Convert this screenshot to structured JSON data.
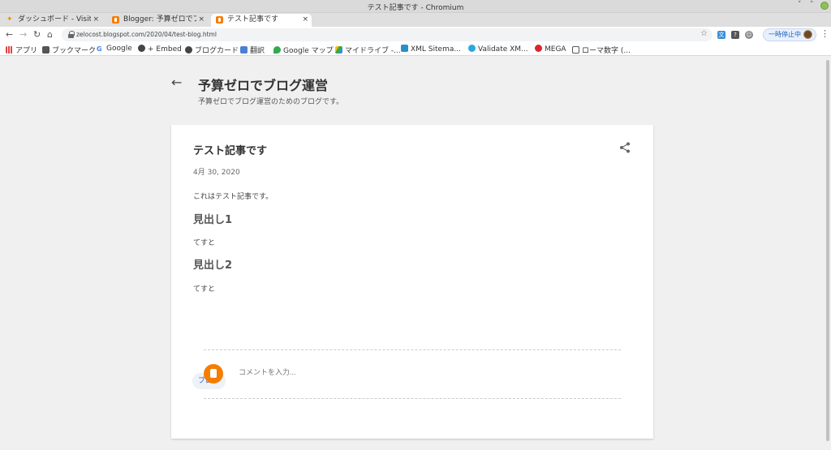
{
  "window": {
    "title": "テスト記事です - Chromium"
  },
  "tabs": [
    {
      "label": "ダッシュボード - Visitors",
      "close": "×"
    },
    {
      "label": "Blogger: 予算ゼロでブログ",
      "close": "×"
    },
    {
      "label": "テスト記事です",
      "close": "×"
    }
  ],
  "toolbar": {
    "url": "zelocost.blogspot.com/2020/04/test-blog.html",
    "pause_label": "一時停止中"
  },
  "bookmarks": [
    {
      "label": "アプリ",
      "icon": "apps-grid-icon"
    },
    {
      "label": "ブックマーク",
      "icon": "folder-icon"
    },
    {
      "label": "Google",
      "icon": "google-icon"
    },
    {
      "label": "+ Embed",
      "icon": "globe-icon"
    },
    {
      "label": "ブログカード",
      "icon": "globe-icon"
    },
    {
      "label": "翻訳",
      "icon": "translate-icon"
    },
    {
      "label": "Google マップ",
      "icon": "maps-pin-icon"
    },
    {
      "label": "マイドライブ -...",
      "icon": "drive-icon"
    },
    {
      "label": "XML Sitema...",
      "icon": "chart-icon"
    },
    {
      "label": "Validate XM...",
      "icon": "globe-icon"
    },
    {
      "label": "MEGA",
      "icon": "mega-icon"
    },
    {
      "label": "ローマ数字 (...",
      "icon": "doc-icon"
    }
  ],
  "blog": {
    "title": "予算ゼロでブログ運営",
    "description": "予算ゼロでブログ運営のためのブログです。"
  },
  "post": {
    "title": "テスト記事です",
    "date": "4月 30, 2020",
    "intro": "これはテスト記事です。",
    "heading1": "見出し1",
    "text1": "てすと",
    "heading2": "見出し2",
    "text2": "てすと",
    "label": "ブログ"
  },
  "comments": {
    "placeholder": "コメントを入力..."
  },
  "colors": {
    "accent": "#3367d6",
    "blogger_orange": "#f57d00"
  }
}
